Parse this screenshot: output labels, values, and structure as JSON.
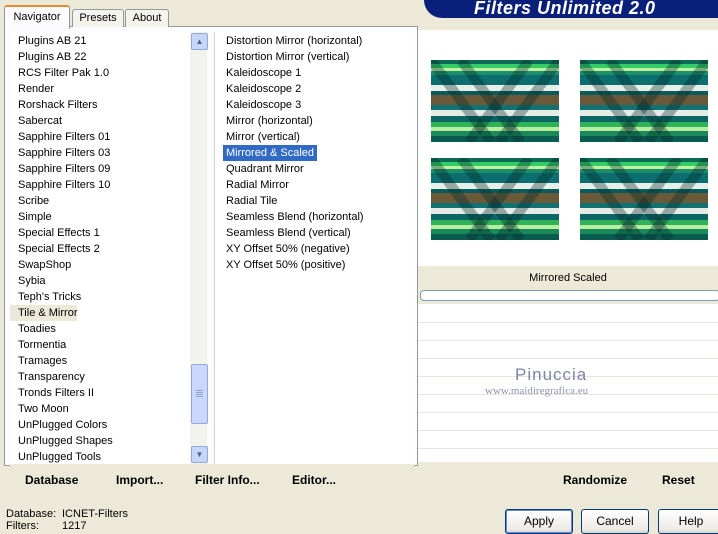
{
  "app": {
    "title": "Filters Unlimited 2.0"
  },
  "tabs": [
    {
      "label": "Navigator",
      "active": true
    },
    {
      "label": "Presets",
      "active": false
    },
    {
      "label": "About",
      "active": false
    }
  ],
  "categories": {
    "items": [
      "Plugins AB 21",
      "Plugins AB 22",
      "RCS Filter Pak 1.0",
      "Render",
      "Rorshack Filters",
      "Sabercat",
      "Sapphire Filters 01",
      "Sapphire Filters 03",
      "Sapphire Filters 09",
      "Sapphire Filters 10",
      "Scribe",
      "Simple",
      "Special Effects 1",
      "Special Effects 2",
      "SwapShop",
      "Sybia",
      "Teph's Tricks",
      "Tile & Mirror",
      "Toadies",
      "Tormentia",
      "Tramages",
      "Transparency",
      "Tronds Filters II",
      "Two Moon",
      "UnPlugged Colors",
      "UnPlugged Shapes",
      "UnPlugged Tools"
    ],
    "selected": "Tile & Mirror"
  },
  "filters": {
    "items": [
      "Distortion Mirror (horizontal)",
      "Distortion Mirror (vertical)",
      "Kaleidoscope 1",
      "Kaleidoscope 2",
      "Kaleidoscope 3",
      "Mirror (horizontal)",
      "Mirror (vertical)",
      "Mirrored & Scaled",
      "Quadrant Mirror",
      "Radial Mirror",
      "Radial Tile",
      "Seamless Blend (horizontal)",
      "Seamless Blend (vertical)",
      "XY Offset 50% (negative)",
      "XY Offset 50% (positive)"
    ],
    "selected": "Mirrored & Scaled"
  },
  "actions": {
    "database": "Database",
    "import": "Import...",
    "filter_info": "Filter Info...",
    "editor": "Editor...",
    "randomize": "Randomize",
    "reset": "Reset"
  },
  "preview": {
    "filter_name": "Mirrored  Scaled"
  },
  "watermark": {
    "title": "Pinuccia",
    "url": "www.maidiregrafica.eu"
  },
  "status": {
    "database_label": "Database:",
    "database_value": "ICNET-Filters",
    "filters_label": "Filters:",
    "filters_value": "1217"
  },
  "dialog_buttons": {
    "apply": "Apply",
    "cancel": "Cancel",
    "help": "Help"
  },
  "icons": {
    "scroll_up": "chevron-up-icon",
    "scroll_down": "chevron-down-icon"
  },
  "colors": {
    "banner": "#0a1f7a",
    "selection": "#316ac5",
    "tab_highlight": "#e68b2c"
  }
}
